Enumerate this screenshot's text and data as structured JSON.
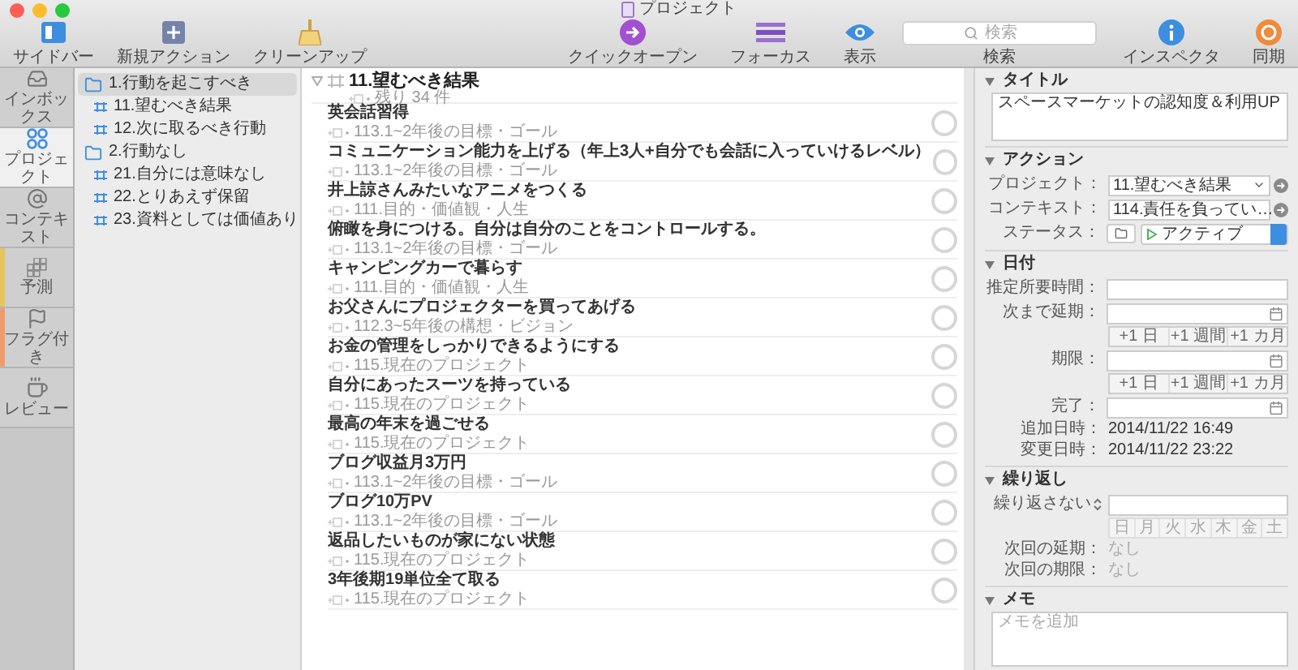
{
  "window": {
    "title": "プロジェクト"
  },
  "toolbar": {
    "left": [
      {
        "kind": "sidebar",
        "label": "サイドバー"
      },
      {
        "kind": "new_action",
        "label": "新規アクション"
      },
      {
        "kind": "cleanup",
        "label": "クリーンアップ"
      }
    ],
    "right": [
      {
        "kind": "quick_open",
        "label": "クイックオープン"
      },
      {
        "kind": "focus",
        "label": "フォーカス"
      },
      {
        "kind": "view",
        "label": "表示"
      },
      {
        "kind": "search",
        "label": "検索",
        "placeholder": "検索"
      },
      {
        "kind": "inspector",
        "label": "インスペクタ"
      },
      {
        "kind": "sync",
        "label": "同期"
      }
    ]
  },
  "perspectives": [
    {
      "kind": "inbox",
      "label": "インボックス",
      "selected": false
    },
    {
      "kind": "projects",
      "label": "プロジェクト",
      "selected": true
    },
    {
      "kind": "contexts",
      "label": "コンテキスト",
      "selected": false
    },
    {
      "kind": "forecast",
      "label": "予測",
      "selected": false,
      "color": "#e8c35c"
    },
    {
      "kind": "flagged",
      "label": "フラグ付き",
      "selected": false,
      "color": "#ef9b6d"
    },
    {
      "kind": "review",
      "label": "レビュー",
      "selected": false
    }
  ],
  "sidebar": {
    "items": [
      {
        "kind": "folder",
        "label": "1.行動を起こすべき",
        "selected": true,
        "children": [
          {
            "kind": "project",
            "label": "11.望むべき結果",
            "selected": false
          },
          {
            "kind": "project",
            "label": "12.次に取るべき行動",
            "selected": false
          }
        ]
      },
      {
        "kind": "folder",
        "label": "2.行動なし",
        "selected": false,
        "children": [
          {
            "kind": "project",
            "label": "21.自分には意味なし",
            "selected": false
          },
          {
            "kind": "project",
            "label": "22.とりあえず保留",
            "selected": false
          },
          {
            "kind": "project",
            "label": "23.資料としては価値あり",
            "selected": false
          }
        ]
      }
    ]
  },
  "outline": {
    "title": "11.望むべき結果",
    "expanded": true,
    "remaining": "残り 34 件",
    "tasks": [
      {
        "title": "英会話習得",
        "context": "113.1~2年後の目標・ゴール",
        "checked": false
      },
      {
        "title": "コミュニケーション能力を上げる（年上3人+自分でも会話に入っていけるレベル）",
        "context": "113.1~2年後の目標・ゴール",
        "checked": false
      },
      {
        "title": "井上諒さんみたいなアニメをつくる",
        "context": "111.目的・価値観・人生",
        "checked": false
      },
      {
        "title": "俯瞰を身につける。自分は自分のことをコントロールする。",
        "context": "113.1~2年後の目標・ゴール",
        "checked": false
      },
      {
        "title": "キャンピングカーで暮らす",
        "context": "111.目的・価値観・人生",
        "checked": false
      },
      {
        "title": "お父さんにプロジェクターを買ってあげる",
        "context": "112.3~5年後の構想・ビジョン",
        "checked": false
      },
      {
        "title": "お金の管理をしっかりできるようにする",
        "context": "115.現在のプロジェクト",
        "checked": false
      },
      {
        "title": "自分にあったスーツを持っている",
        "context": "115.現在のプロジェクト",
        "checked": false
      },
      {
        "title": "最高の年末を過ごせる",
        "context": "115.現在のプロジェクト",
        "checked": false
      },
      {
        "title": "ブログ収益月3万円",
        "context": "113.1~2年後の目標・ゴール",
        "checked": false
      },
      {
        "title": "ブログ10万PV",
        "context": "113.1~2年後の目標・ゴール",
        "checked": false
      },
      {
        "title": "返品したいものが家にない状態",
        "context": "115.現在のプロジェクト",
        "checked": false
      },
      {
        "title": "3年後期19単位全て取る",
        "context": "115.現在のプロジェクト",
        "checked": false
      }
    ]
  },
  "inspector": {
    "title_section": {
      "heading": "タイトル",
      "value": "スペースマーケットの認知度＆利用UP"
    },
    "action": {
      "heading": "アクション",
      "project_label": "プロジェクト：",
      "project": "11.望むべき結果",
      "context_label": "コンテキスト：",
      "context": "114.責任を負ってい…",
      "status_label": "ステータス：",
      "status": "アクティブ"
    },
    "dates": {
      "heading": "日付",
      "estimate_label": "推定所要時間：",
      "defer_label": "次まで延期：",
      "defer_buttons": [
        "+1 日",
        "+1 週間",
        "+1 カ月"
      ],
      "due_label": "期限：",
      "due_buttons": [
        "+1 日",
        "+1 週間",
        "+1 カ月"
      ],
      "completed_label": "完了：",
      "added_label": "追加日時：",
      "added": "2014/11/22 16:49",
      "modified_label": "変更日時：",
      "modified": "2014/11/22 23:22"
    },
    "repeat": {
      "heading": "繰り返し",
      "rule": "繰り返さない",
      "weekdays": [
        "日",
        "月",
        "火",
        "水",
        "木",
        "金",
        "土"
      ],
      "next_defer_label": "次回の延期：",
      "next_defer": "なし",
      "next_due_label": "次回の期限：",
      "next_due": "なし"
    },
    "memo": {
      "heading": "メモ",
      "placeholder": "メモを追加"
    }
  }
}
